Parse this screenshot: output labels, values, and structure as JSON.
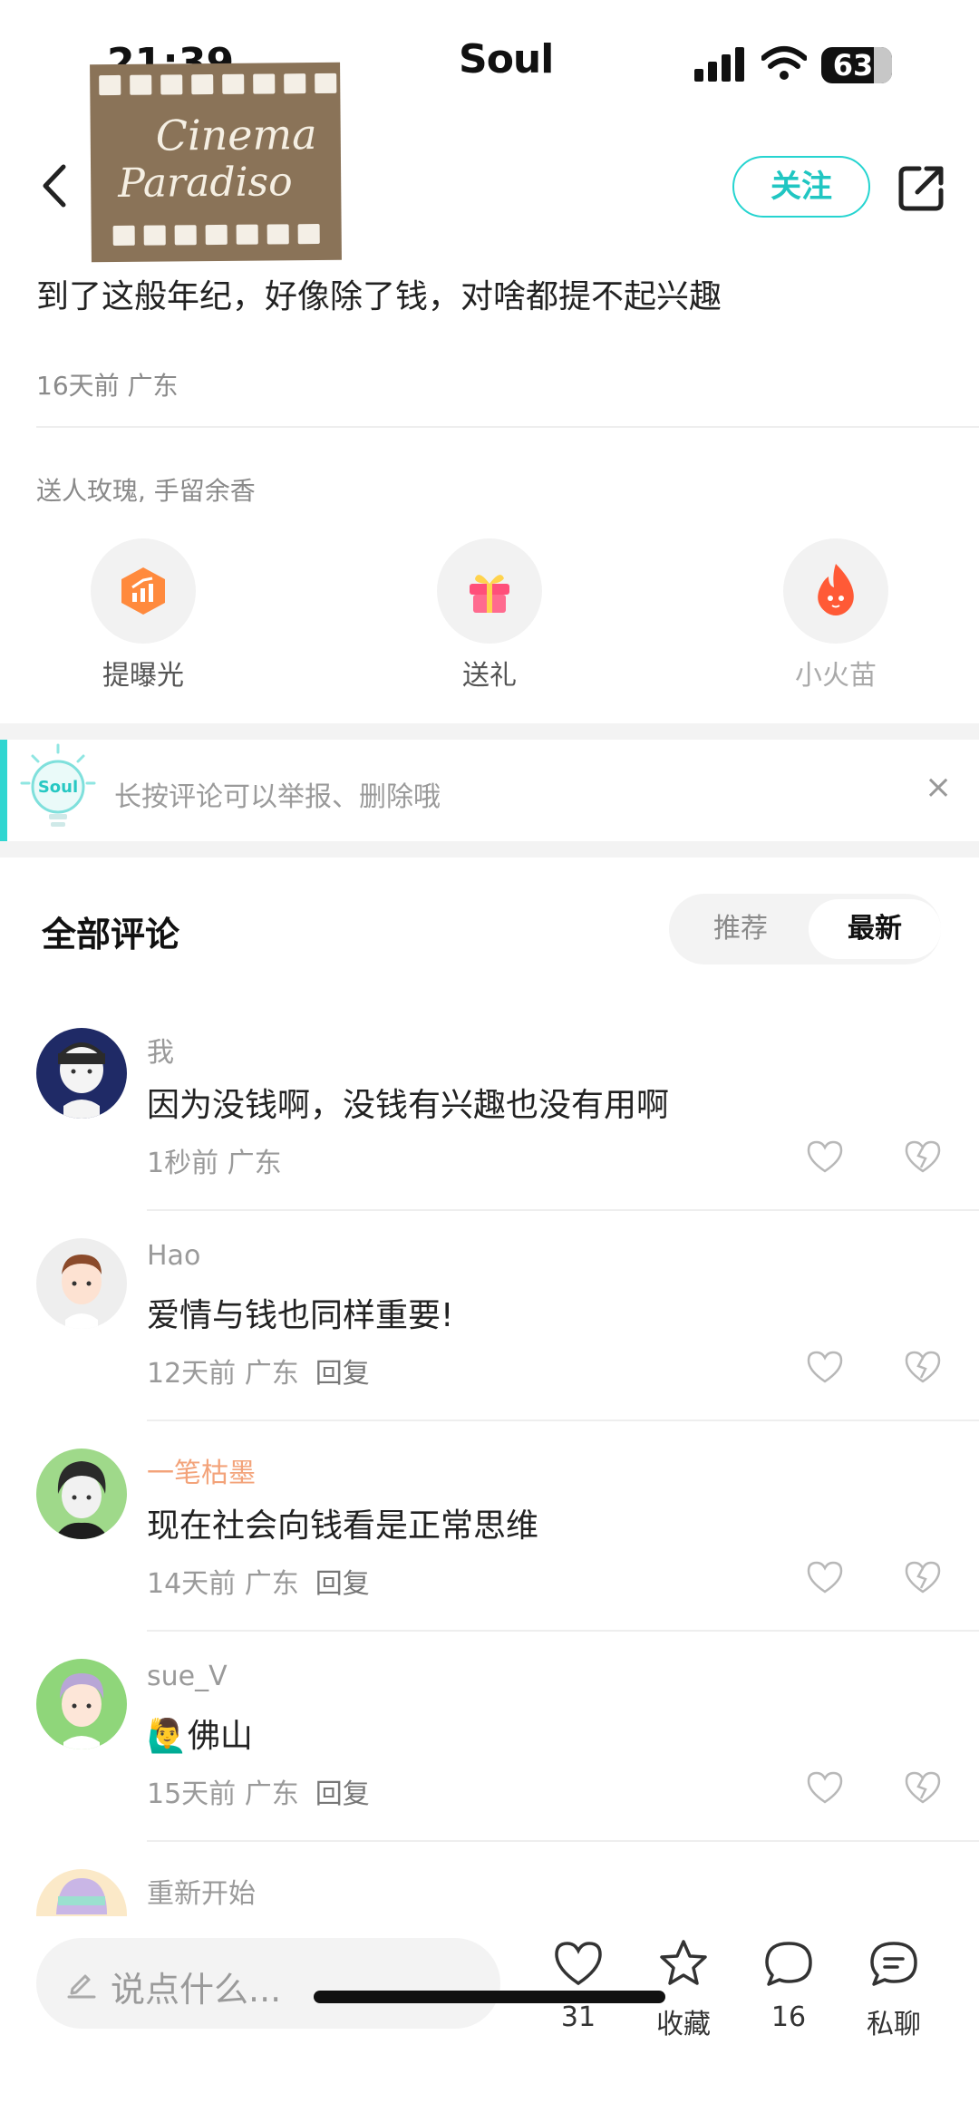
{
  "status_bar": {
    "time": "21:39",
    "app_name": "Soul",
    "battery": "63"
  },
  "sticker": {
    "line1": "Cinema",
    "line2": "Paradiso"
  },
  "header": {
    "follow_label": "关注"
  },
  "post": {
    "text": "到了这般年纪，好像除了钱，对啥都提不起兴趣",
    "meta": "16天前  广东"
  },
  "gifts": {
    "caption": "送人玫瑰, 手留余香",
    "actions": [
      {
        "label": "提曝光",
        "icon": "boost-icon"
      },
      {
        "label": "送礼",
        "icon": "gift-icon"
      },
      {
        "label": "小火苗",
        "icon": "flame-icon"
      }
    ]
  },
  "tip": {
    "badge": "Soul",
    "text": "长按评论可以举报、删除哦",
    "close": "×"
  },
  "comments_section": {
    "title": "全部评论",
    "sort_options": [
      "推荐",
      "最新"
    ],
    "selected_sort": "最新",
    "items": [
      {
        "name": "我",
        "text": "因为没钱啊，没钱有兴趣也没有用啊",
        "meta": "1秒前  广东",
        "reply": ""
      },
      {
        "name": "Hao",
        "text": "爱情与钱也同样重要!",
        "meta": "12天前  广东",
        "reply": "回复"
      },
      {
        "name": "一笔枯墨",
        "text": "现在社会向钱看是正常思维",
        "meta": "14天前  广东",
        "reply": "回复"
      },
      {
        "name": "sue_V",
        "text": "🙋‍♂️佛山",
        "meta": "15天前  广东",
        "reply": "回复"
      },
      {
        "name": "重新开始",
        "text": "",
        "meta": "",
        "reply": ""
      }
    ]
  },
  "bottom_bar": {
    "input_placeholder": "说点什么...",
    "like_count": "31",
    "collect_label": "收藏",
    "comment_count": "16",
    "chat_label": "私聊"
  },
  "colors": {
    "accent": "#25d4d0",
    "orange_name": "#f3a37a"
  }
}
